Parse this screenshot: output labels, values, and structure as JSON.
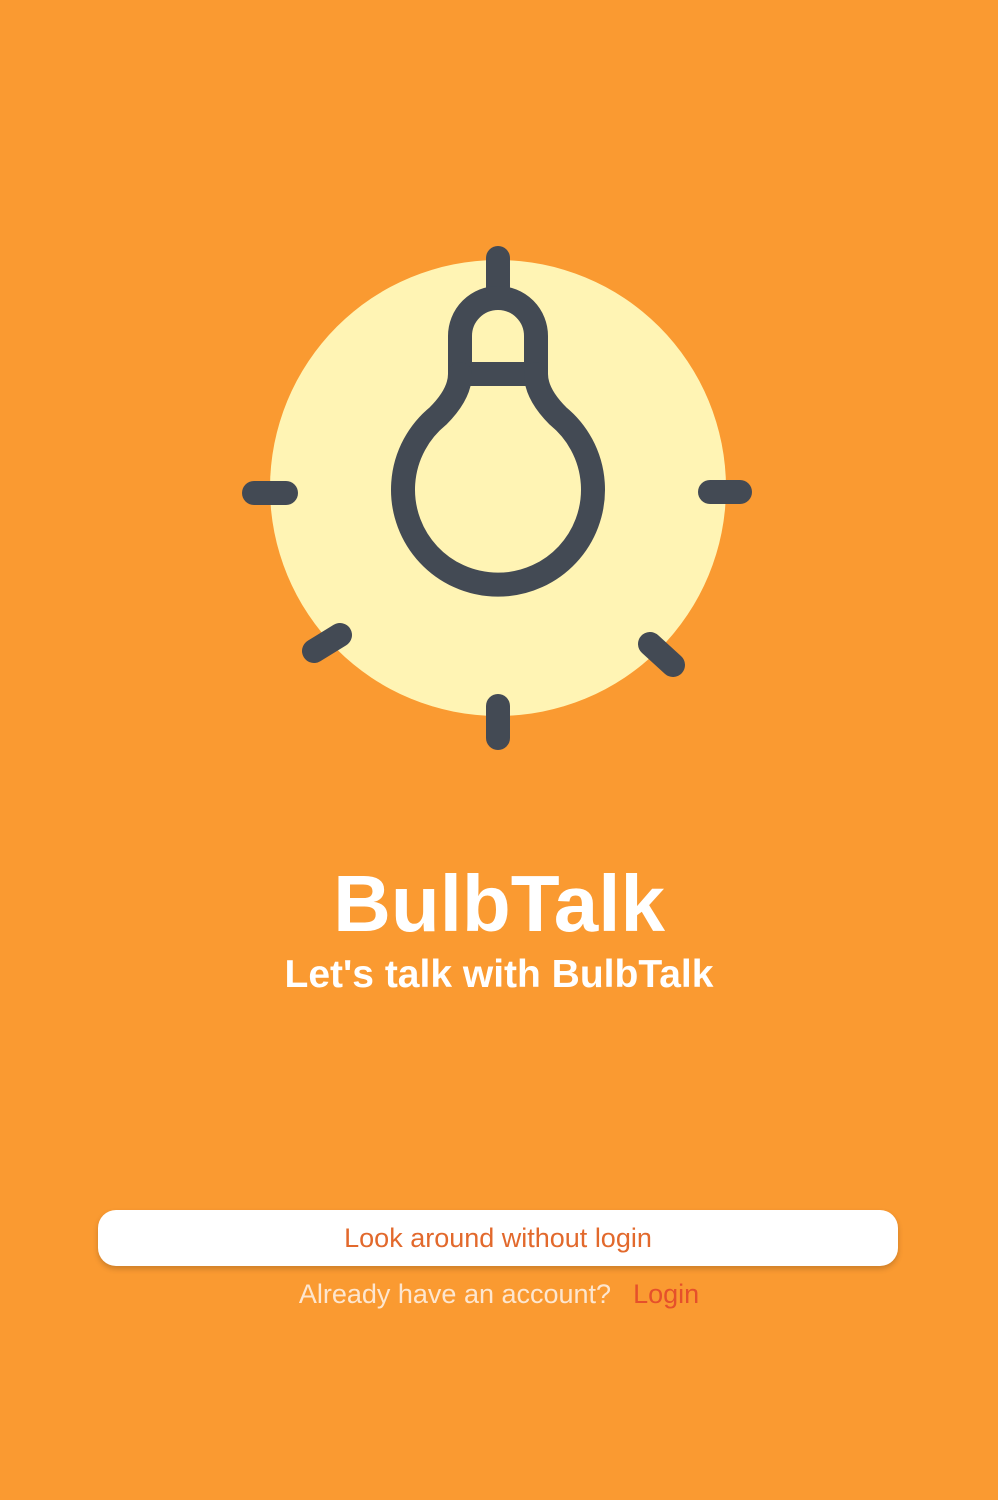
{
  "app": {
    "title": "BulbTalk",
    "tagline": "Let's talk with BulbTalk"
  },
  "logo": {
    "icon": "lightbulb-icon",
    "circle_color": "#FFF4B4",
    "stroke_color": "#434A54"
  },
  "actions": {
    "guest_label": "Look around without login",
    "account_question": "Already have an account?",
    "login_label": "Login"
  },
  "colors": {
    "background": "#FA9A31",
    "button_text": "#E2692C",
    "login_link": "#E5502B"
  }
}
